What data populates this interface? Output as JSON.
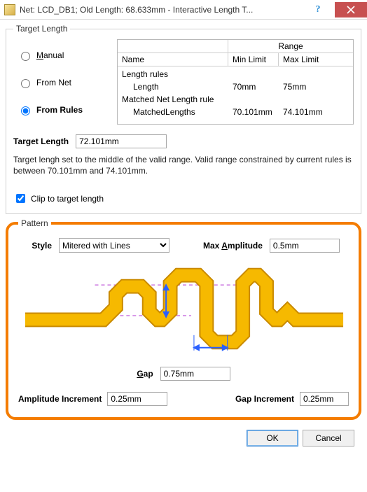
{
  "titlebar": {
    "title": "Net: LCD_DB1;  Old Length: 68.633mm  -  Interactive Length T..."
  },
  "target_length": {
    "legend": "Target Length",
    "radios": {
      "manual": "Manual",
      "from_net": "From Net",
      "from_rules": "From Rules"
    },
    "selected_radio": "from_rules",
    "table": {
      "range_label": "Range",
      "headers": {
        "name": "Name",
        "min": "Min Limit",
        "max": "Max Limit"
      },
      "rows": [
        {
          "kind": "section",
          "name": "Length rules"
        },
        {
          "kind": "item",
          "name": "Length",
          "min": "70mm",
          "max": "75mm"
        },
        {
          "kind": "section",
          "name": "Matched Net Length rule"
        },
        {
          "kind": "item",
          "name": "MatchedLengths",
          "min": "70.101mm",
          "max": "74.101mm"
        }
      ]
    },
    "length_label": "Target Length",
    "length_value": "72.101mm",
    "help_text": "Target lengh set to the middle of the valid range. Valid range constrained by current rules is between 70.101mm and 74.101mm.",
    "clip_label": "Clip to target length",
    "clip_checked": true
  },
  "pattern": {
    "legend": "Pattern",
    "style_label": "Style",
    "style_value": "Mitered with Lines",
    "max_amp_label": "Max Amplitude",
    "max_amp_value": "0.5mm",
    "gap_label": "Gap",
    "gap_value": "0.75mm",
    "amp_inc_label": "Amplitude Increment",
    "amp_inc_value": "0.25mm",
    "gap_inc_label": "Gap Increment",
    "gap_inc_value": "0.25mm"
  },
  "footer": {
    "ok": "OK",
    "cancel": "Cancel"
  },
  "colors": {
    "highlight_border": "#f47c00",
    "trace_fill": "#f6b900",
    "trace_stroke": "#c98a00",
    "guide": "#3a50ff"
  }
}
